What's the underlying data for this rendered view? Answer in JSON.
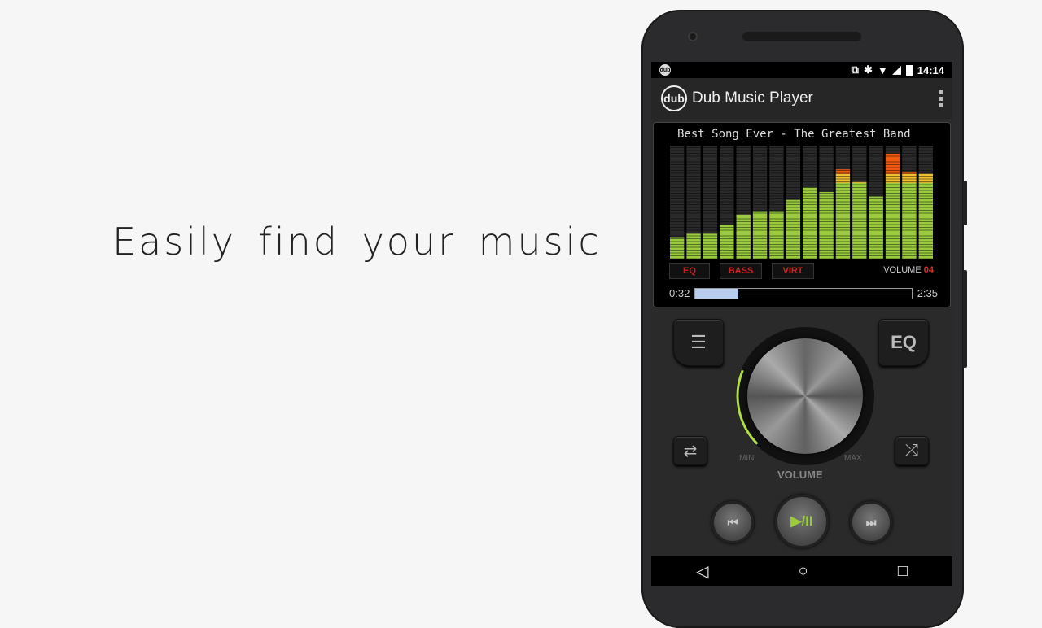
{
  "tagline": "Easily find your music",
  "status": {
    "time": "14:14",
    "icons": [
      "cast-icon",
      "bluetooth-icon",
      "wifi-icon",
      "signal-icon",
      "battery-icon"
    ]
  },
  "app": {
    "logo": "dub",
    "title": "Dub Music Player"
  },
  "player": {
    "song": "Best Song Ever - The Greatest Band",
    "eq_levels": [
      0.19,
      0.22,
      0.22,
      0.3,
      0.39,
      0.42,
      0.42,
      0.52,
      0.63,
      0.59,
      0.79,
      0.68,
      0.55,
      0.93,
      0.77,
      0.75
    ],
    "toggles": [
      "EQ",
      "BASS",
      "VIRT"
    ],
    "volume_label": "VOLUME",
    "volume_value": "04",
    "elapsed": "0:32",
    "total": "2:35",
    "progress": 0.2,
    "colors": {
      "green": "#9acb3c",
      "yellow": "#f0c030",
      "orange": "#f05a10",
      "toggle": "#d42020"
    }
  },
  "controls": {
    "eq_button": "EQ",
    "min": "MIN",
    "max": "MAX",
    "volume": "VOLUME",
    "knob_level": 0.25,
    "play_pause": "▶/II",
    "prev": "⏮",
    "next": "⏭"
  },
  "nav": {
    "back": "◁",
    "home": "○",
    "recents": "□"
  }
}
